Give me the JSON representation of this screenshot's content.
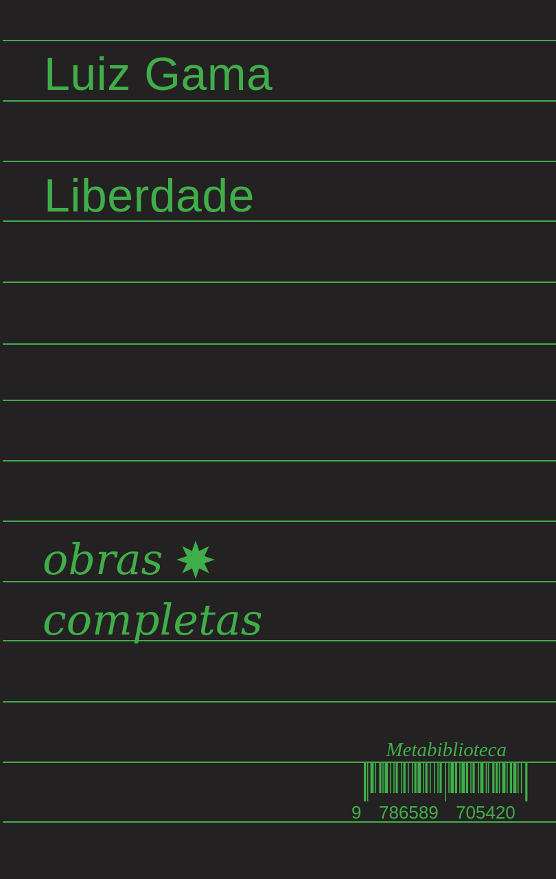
{
  "cover": {
    "author": "Luiz Gama",
    "title": "Liberdade",
    "series_line1": "obras",
    "series_line2": "completas",
    "publisher": "Metabiblioteca",
    "isbn_digits": {
      "lead": "9",
      "group1": "786589",
      "group2": "705420"
    }
  },
  "icons": {
    "series_mark": "eight-point-star-icon",
    "barcode": "barcode"
  },
  "colors": {
    "background": "#242122",
    "accent": "#3fae49"
  }
}
